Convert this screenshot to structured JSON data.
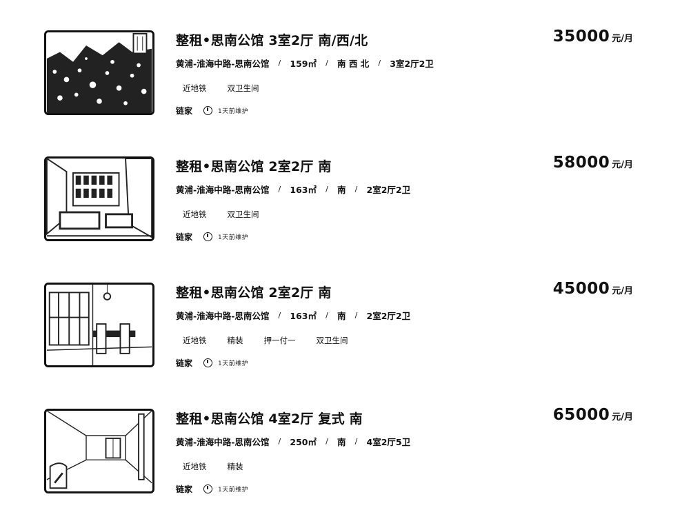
{
  "listings": [
    {
      "title": "整租•思南公馆 3室2厅 南/西/北",
      "location": "黄浦-淮海中路-思南公馆",
      "area": "159㎡",
      "orientation": "南 西 北",
      "layout": "3室2厅2卫",
      "tags": [
        "近地铁",
        "双卫生间"
      ],
      "brand": "链家",
      "updated": "1天前维护",
      "price": "35000",
      "price_unit": "元/月",
      "thumb_icon": "building-photo-icon"
    },
    {
      "title": "整租•思南公馆 2室2厅 南",
      "location": "黄浦-淮海中路-思南公馆",
      "area": "163㎡",
      "orientation": "南",
      "layout": "2室2厅2卫",
      "tags": [
        "近地铁",
        "双卫生间"
      ],
      "brand": "链家",
      "updated": "1天前维护",
      "price": "58000",
      "price_unit": "元/月",
      "thumb_icon": "living-room-photo-icon"
    },
    {
      "title": "整租•思南公馆 2室2厅 南",
      "location": "黄浦-淮海中路-思南公馆",
      "area": "163㎡",
      "orientation": "南",
      "layout": "2室2厅2卫",
      "tags": [
        "近地铁",
        "精装",
        "押一付一",
        "双卫生间"
      ],
      "brand": "链家",
      "updated": "1天前维护",
      "price": "45000",
      "price_unit": "元/月",
      "thumb_icon": "dining-room-photo-icon"
    },
    {
      "title": "整租•思南公馆 4室2厅 复式 南",
      "location": "黄浦-淮海中路-思南公馆",
      "area": "250㎡",
      "orientation": "南",
      "layout": "4室2厅5卫",
      "tags": [
        "近地铁",
        "精装"
      ],
      "brand": "链家",
      "updated": "1天前维护",
      "price": "65000",
      "price_unit": "元/月",
      "thumb_icon": "empty-room-photo-icon"
    }
  ]
}
